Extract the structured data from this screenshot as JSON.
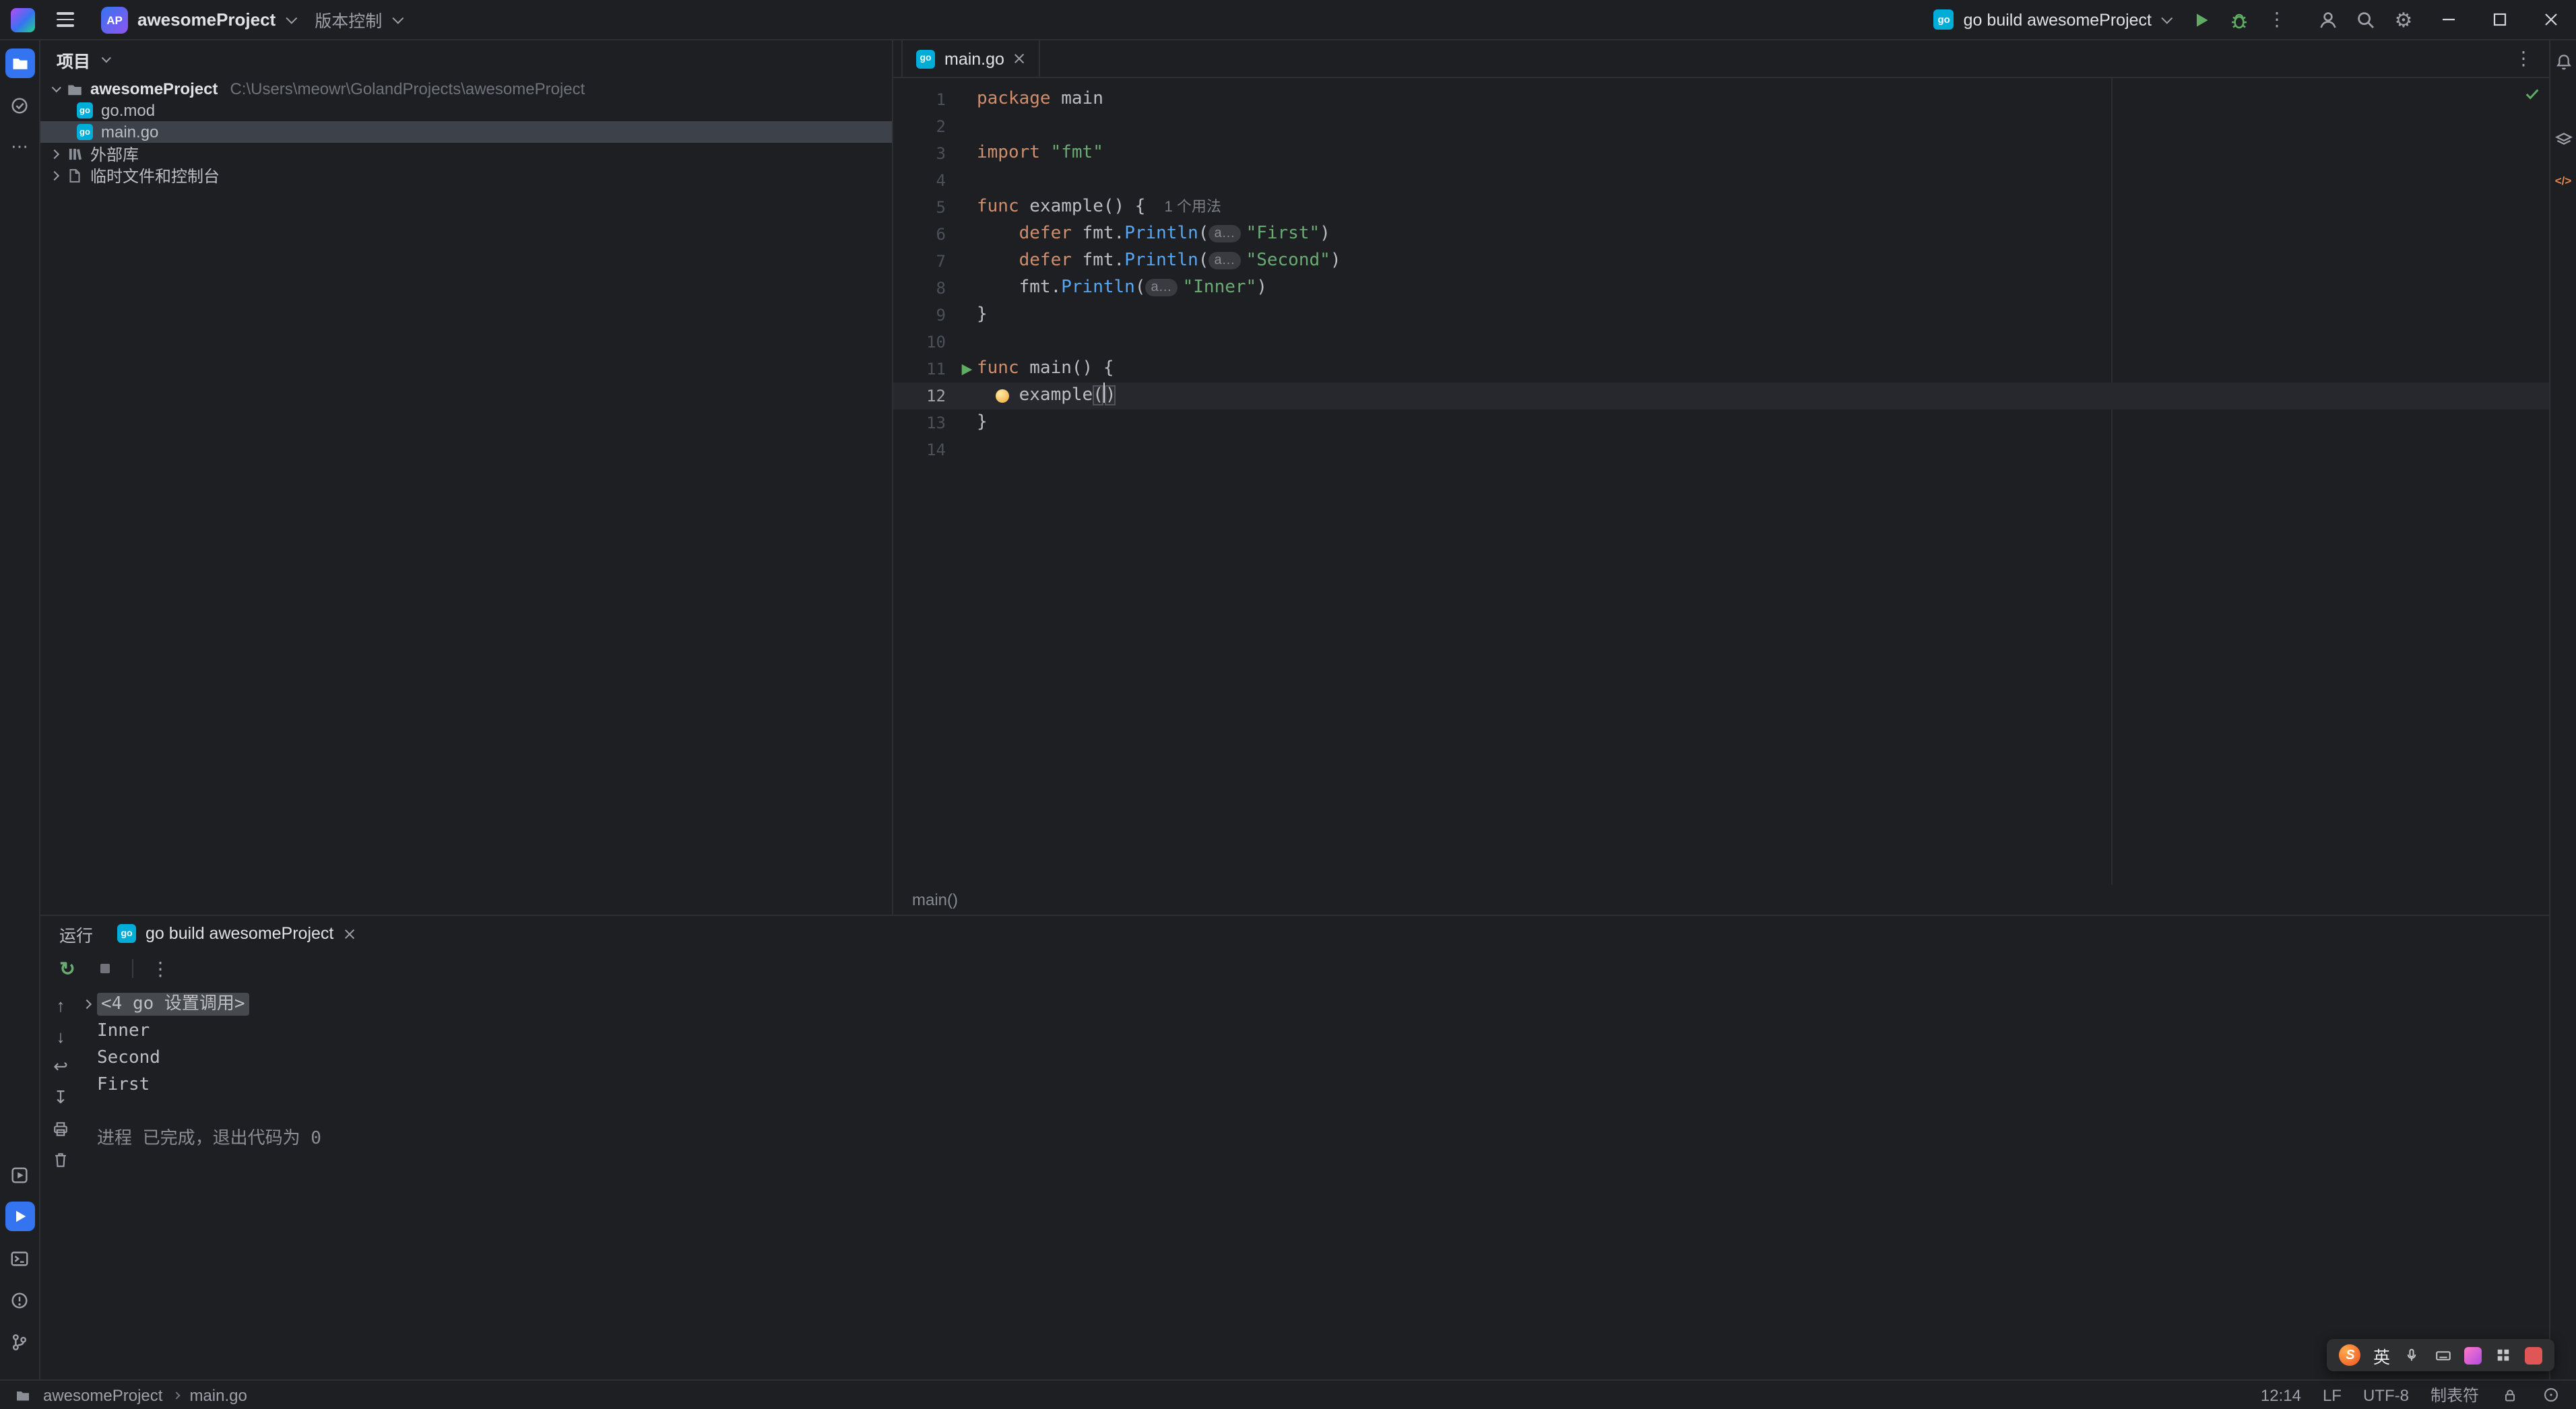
{
  "glyphs": {
    "gear": "⚙",
    "more_vertical": "⋮",
    "more_horizontal": "⋯",
    "go_chip": "go",
    "code_tag": "</>",
    "rerun": "↻",
    "arrow_up": "↑",
    "arrow_down": "↓",
    "soft_wrap": "↩",
    "scroll_end": "↧"
  },
  "titlebar": {
    "project_badge": "AP",
    "project_name": "awesomeProject",
    "vcs_label": "版本控制",
    "run_config": "go build awesomeProject"
  },
  "project_panel": {
    "header": "项目",
    "tree": [
      {
        "name": "awesomeProject",
        "path": "C:\\Users\\meowr\\GolandProjects\\awesomeProject"
      },
      {
        "name": "go.mod"
      },
      {
        "name": "main.go"
      },
      {
        "name": "外部库"
      },
      {
        "name": "临时文件和控制台"
      }
    ]
  },
  "editor": {
    "tab": "main.go",
    "breadcrumb": "main()",
    "lines": [
      {
        "n": 1,
        "tokens": [
          {
            "c": "kw",
            "t": "package"
          },
          {
            "c": "pl",
            "t": " main"
          }
        ]
      },
      {
        "n": 2,
        "tokens": []
      },
      {
        "n": 3,
        "tokens": [
          {
            "c": "kw",
            "t": "import"
          },
          {
            "c": "pl",
            "t": " "
          },
          {
            "c": "str",
            "t": "\"fmt\""
          }
        ]
      },
      {
        "n": 4,
        "tokens": []
      },
      {
        "n": 5,
        "tokens": [
          {
            "c": "kw",
            "t": "func"
          },
          {
            "c": "pl",
            "t": " example() {"
          },
          {
            "c": "inlay",
            "t": "1 个用法"
          }
        ]
      },
      {
        "n": 6,
        "tokens": [
          {
            "c": "pl",
            "t": "    "
          },
          {
            "c": "kw",
            "t": "defer"
          },
          {
            "c": "pl",
            "t": " fmt."
          },
          {
            "c": "fn",
            "t": "Println"
          },
          {
            "c": "pl",
            "t": "("
          },
          {
            "c": "hint",
            "t": "a…"
          },
          {
            "c": "str",
            "t": "\"First\""
          },
          {
            "c": "pl",
            "t": ")"
          }
        ]
      },
      {
        "n": 7,
        "tokens": [
          {
            "c": "pl",
            "t": "    "
          },
          {
            "c": "kw",
            "t": "defer"
          },
          {
            "c": "pl",
            "t": " fmt."
          },
          {
            "c": "fn",
            "t": "Println"
          },
          {
            "c": "pl",
            "t": "("
          },
          {
            "c": "hint",
            "t": "a…"
          },
          {
            "c": "str",
            "t": "\"Second\""
          },
          {
            "c": "pl",
            "t": ")"
          }
        ]
      },
      {
        "n": 8,
        "tokens": [
          {
            "c": "pl",
            "t": "    fmt."
          },
          {
            "c": "fn",
            "t": "Println"
          },
          {
            "c": "pl",
            "t": "("
          },
          {
            "c": "hint",
            "t": "a…"
          },
          {
            "c": "str",
            "t": "\"Inner\""
          },
          {
            "c": "pl",
            "t": ")"
          }
        ]
      },
      {
        "n": 9,
        "tokens": [
          {
            "c": "pl",
            "t": "}"
          }
        ]
      },
      {
        "n": 10,
        "tokens": []
      },
      {
        "n": 11,
        "gutter": "run",
        "tokens": [
          {
            "c": "kw",
            "t": "func"
          },
          {
            "c": "pl",
            "t": " main() {"
          }
        ]
      },
      {
        "n": 12,
        "current": true,
        "bulb": true,
        "tokens": [
          {
            "c": "pl",
            "t": "    example"
          },
          {
            "c": "brace",
            "t": "("
          },
          {
            "c": "caret",
            "t": ""
          },
          {
            "c": "brace",
            "t": ")"
          }
        ]
      },
      {
        "n": 13,
        "tokens": [
          {
            "c": "pl",
            "t": "}"
          }
        ]
      },
      {
        "n": 14,
        "tokens": []
      }
    ]
  },
  "run_panel": {
    "title": "运行",
    "tab": "go build awesomeProject",
    "console_lines": [
      {
        "type": "fold",
        "text": "<4 go 设置调用>"
      },
      {
        "type": "out",
        "text": "Inner"
      },
      {
        "type": "out",
        "text": "Second"
      },
      {
        "type": "out",
        "text": "First"
      },
      {
        "type": "blank",
        "text": ""
      },
      {
        "type": "exit",
        "text": "进程 已完成，退出代码为 0"
      }
    ]
  },
  "status_bar": {
    "project": "awesomeProject",
    "file": "main.go",
    "caret": "12:14",
    "line_separator": "LF",
    "encoding": "UTF-8",
    "indent": "制表符"
  },
  "ime": {
    "logo": "S",
    "mode": "英"
  }
}
